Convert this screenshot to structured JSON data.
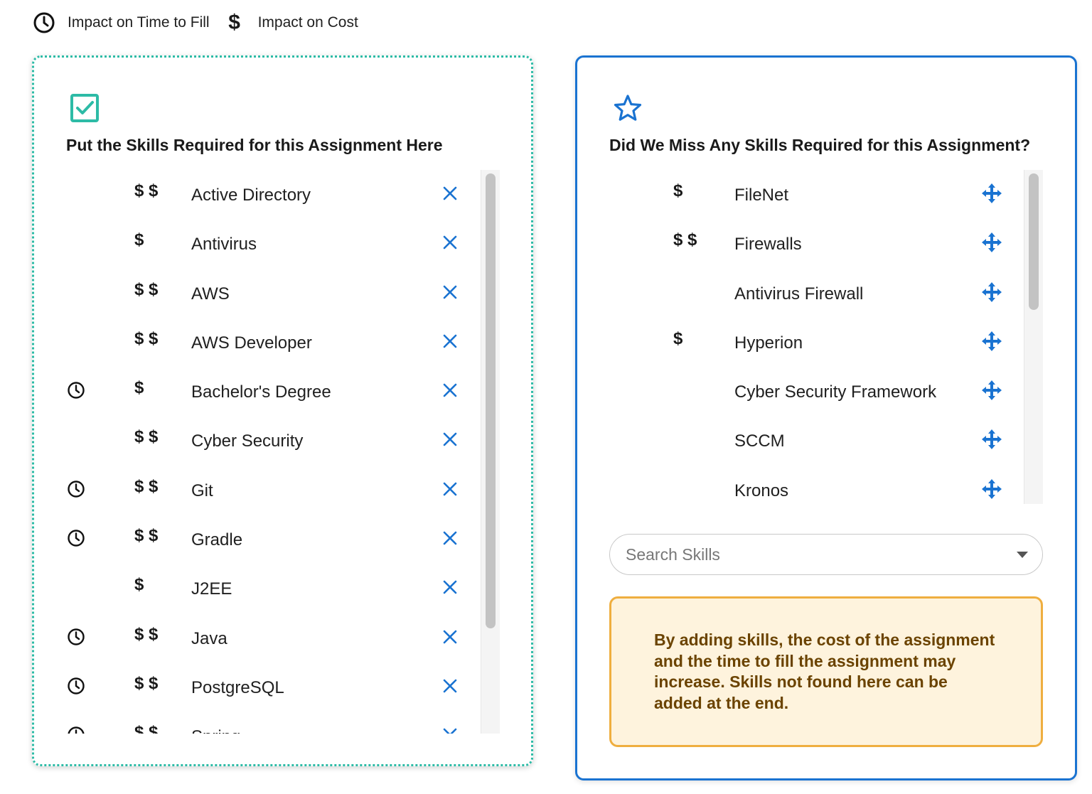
{
  "legend": {
    "time_label": "Impact on Time to Fill",
    "cost_label": "Impact on Cost",
    "time_icon": "clock-icon",
    "cost_icon": "dollar-icon"
  },
  "colors": {
    "required_border": "#2dbba6",
    "suggested_border": "#1a73d1",
    "action_blue": "#1a73d1",
    "notice_bg": "#fef3dd",
    "notice_border": "#efae3f",
    "notice_text": "#6b4300"
  },
  "required_panel": {
    "icon": "checkbox-checked-icon",
    "title": "Put the Skills Required for this Assignment Here",
    "skills": [
      {
        "name": "Active Directory",
        "time": false,
        "cost": "$ $"
      },
      {
        "name": "Antivirus",
        "time": false,
        "cost": "$"
      },
      {
        "name": "AWS",
        "time": false,
        "cost": "$ $"
      },
      {
        "name": "AWS Developer",
        "time": false,
        "cost": "$ $"
      },
      {
        "name": "Bachelor's Degree",
        "time": true,
        "cost": "$"
      },
      {
        "name": "Cyber Security",
        "time": false,
        "cost": "$ $"
      },
      {
        "name": "Git",
        "time": true,
        "cost": "$ $"
      },
      {
        "name": "Gradle",
        "time": true,
        "cost": "$ $"
      },
      {
        "name": "J2EE",
        "time": false,
        "cost": "$"
      },
      {
        "name": "Java",
        "time": true,
        "cost": "$ $"
      },
      {
        "name": "PostgreSQL",
        "time": true,
        "cost": "$ $"
      },
      {
        "name": "Spring",
        "time": true,
        "cost": "$ $"
      }
    ],
    "remove_icon": "close-icon"
  },
  "suggested_panel": {
    "icon": "star-icon",
    "title": "Did We Miss Any Skills Required for this Assignment?",
    "skills": [
      {
        "name": "FileNet",
        "time": false,
        "cost": "$"
      },
      {
        "name": "Firewalls",
        "time": false,
        "cost": "$ $"
      },
      {
        "name": "Antivirus Firewall",
        "time": false,
        "cost": ""
      },
      {
        "name": "Hyperion",
        "time": false,
        "cost": "$"
      },
      {
        "name": "Cyber Security Framework",
        "time": false,
        "cost": ""
      },
      {
        "name": "SCCM",
        "time": false,
        "cost": ""
      },
      {
        "name": "Kronos",
        "time": false,
        "cost": ""
      }
    ],
    "drag_icon": "move-icon",
    "search": {
      "placeholder": "Search Skills",
      "value": ""
    },
    "notice": "By adding skills, the cost of the assignment and the time to fill the assignment may increase. Skills not found here can be added at the end."
  }
}
